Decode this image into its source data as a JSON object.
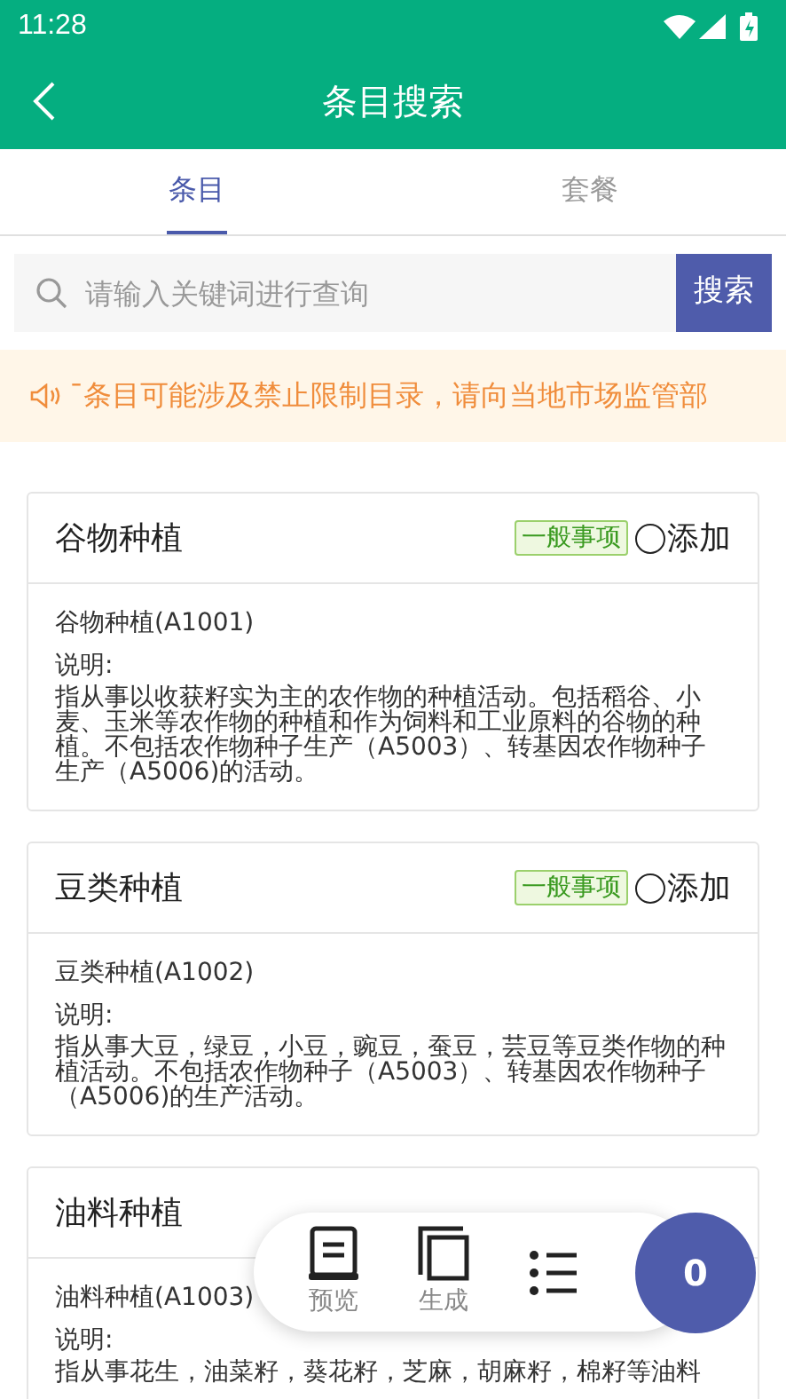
{
  "status_bar": {
    "time": "11:28"
  },
  "header": {
    "title": "条目搜索"
  },
  "tabs": [
    {
      "label": "条目",
      "selected": true
    },
    {
      "label": "套餐",
      "selected": false
    }
  ],
  "search": {
    "placeholder": "请输入关键词进行查询",
    "button": "搜索"
  },
  "notice": {
    "text": "ˉ条目可能涉及禁止限制目录，请向当地市场监管部"
  },
  "items": [
    {
      "title": "谷物种植",
      "tag": "一般事项",
      "add_label": "添加",
      "checked": false,
      "code": "谷物种植(A1001)",
      "desc_label": "说明:",
      "desc": "指从事以收获籽实为主的农作物的种植活动。包括稻谷、小麦、玉米等农作物的种植和作为饲料和工业原料的谷物的种植。不包括农作物种子生产（A5003）、转基因农作物种子生产（A5006)的活动。"
    },
    {
      "title": "豆类种植",
      "tag": "一般事项",
      "add_label": "添加",
      "checked": false,
      "code": "豆类种植(A1002)",
      "desc_label": "说明:",
      "desc": "指从事大豆，绿豆，小豆，豌豆，蚕豆，芸豆等豆类作物的种植活动。不包括农作物种子（A5003）、转基因农作物种子（A5006)的生产活动。"
    },
    {
      "title": "油料种植",
      "code": "油料种植(A1003)",
      "desc_label": "说明:",
      "desc": "指从事花生，油菜籽，葵花籽，芝麻，胡麻籽，棉籽等油料"
    }
  ],
  "float_bar": {
    "buttons": [
      {
        "kind": "preview",
        "label": "预览"
      },
      {
        "kind": "generate",
        "label": "生成"
      },
      {
        "kind": "list"
      }
    ],
    "count": "0"
  }
}
